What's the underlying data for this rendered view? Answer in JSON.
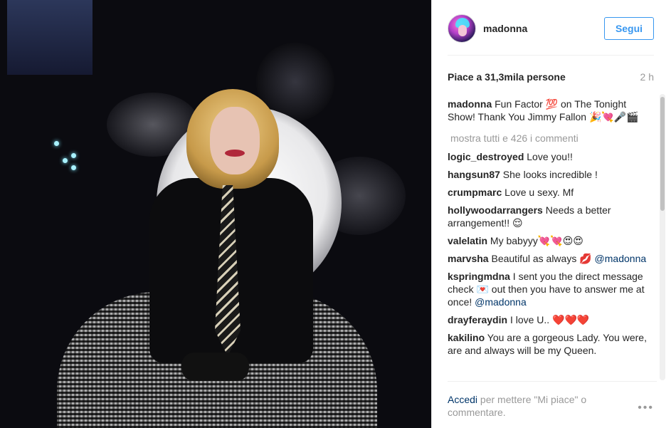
{
  "post": {
    "username": "madonna",
    "follow_label": "Segui",
    "likes": "Piace a 31,3mila persone",
    "time": "2 h"
  },
  "caption": {
    "user": "madonna",
    "text": "Fun Factor 💯 on The Tonight Show! Thank You Jimmy Fallon 🎉💘🎤🎬"
  },
  "show_all": "mostra tutti e 426 i commenti",
  "comments": [
    {
      "user": "logic_destroyed",
      "text": "Love you!!"
    },
    {
      "user": "hangsun87",
      "text": "She looks incredible !"
    },
    {
      "user": "crumpmarc",
      "text": "Love u sexy. Mf"
    },
    {
      "user": "hollywoodarrangers",
      "text": "Needs a better arrangement!! 😌"
    },
    {
      "user": "valelatin",
      "text": "My babyyy💘💘😍😍"
    },
    {
      "user": "marvsha",
      "text": "Beautiful as always 💋",
      "mention": "@madonna"
    },
    {
      "user": "kspringmdna",
      "text": "I sent you the direct message check 💌 out then you have to answer me at once!",
      "mention": "@madonna"
    },
    {
      "user": "drayferaydin",
      "text": "I love U.. ❤️❤️❤️"
    },
    {
      "user": "kakilino",
      "text": "You are a gorgeous Lady. You were, are and always will be my Queen."
    }
  ],
  "footer": {
    "login_link": "Accedi",
    "text": "per mettere \"Mi piace\" o commentare.",
    "more_icon": "ellipsis-icon"
  }
}
